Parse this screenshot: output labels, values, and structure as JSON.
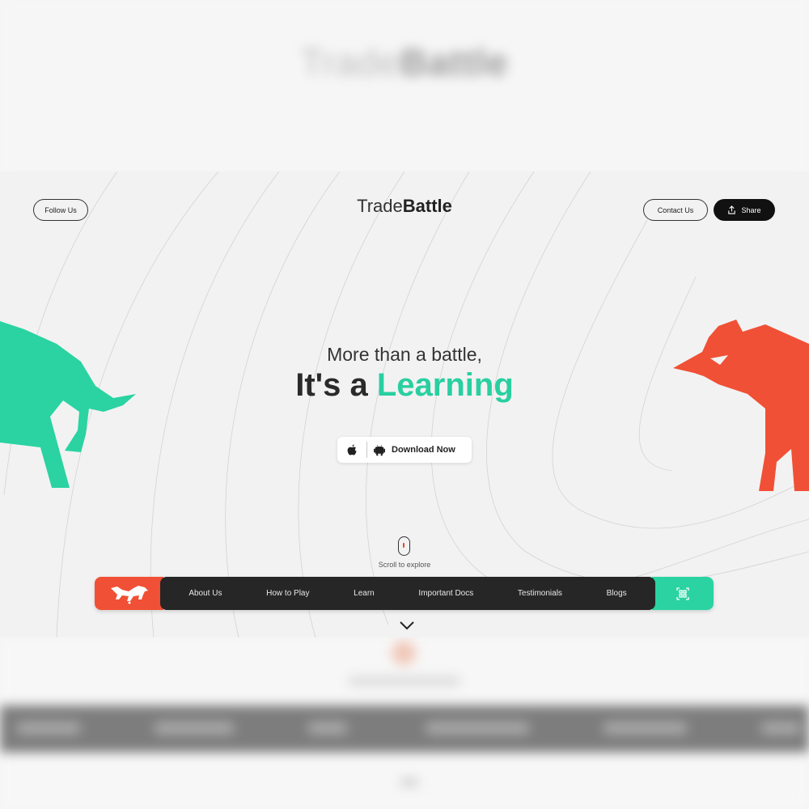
{
  "background": {
    "title_light": "Trade",
    "title_bold": "Battle"
  },
  "header": {
    "follow_label": "Follow Us",
    "logo_light": "Trade",
    "logo_bold": "Battle",
    "contact_label": "Contact Us",
    "share_label": "Share"
  },
  "hero": {
    "line1": "More than a battle,",
    "line2_prefix": "It's a ",
    "line2_accent": "Learning",
    "download_label": "Download Now",
    "scroll_label": "Scroll to explore"
  },
  "nav": {
    "items": [
      {
        "label": "About Us"
      },
      {
        "label": "How to Play"
      },
      {
        "label": "Learn"
      },
      {
        "label": "Important Docs"
      },
      {
        "label": "Testimonials"
      },
      {
        "label": "Blogs"
      }
    ]
  },
  "colors": {
    "bull": "#2ad3a1",
    "bear": "#f05035",
    "nav_dark": "#262626",
    "accent_text": "#29cfa0"
  },
  "icons": {
    "bull": "bull-icon",
    "bear": "bear-icon",
    "apple": "apple-icon",
    "android": "android-icon",
    "share": "share-icon",
    "qr": "qr-scan-icon",
    "mouse": "mouse-scroll-icon",
    "chevron": "chevron-down-icon"
  }
}
